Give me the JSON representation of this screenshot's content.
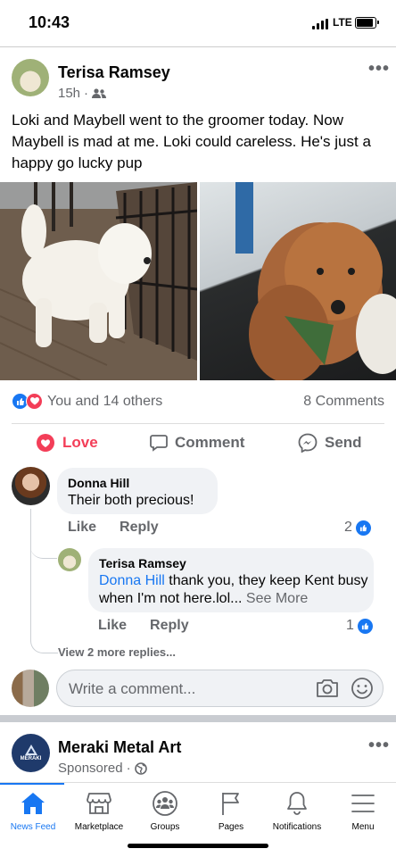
{
  "status_bar": {
    "time": "10:43",
    "network": "LTE"
  },
  "post": {
    "author": "Terisa Ramsey",
    "timestamp": "15h",
    "meta_separator": "·",
    "audience_icon": "friends-icon",
    "more_icon": "more-dots-icon",
    "text": "Loki and Maybell  went to the groomer today. Now Maybell is mad at me. Loki could careless. He's just a happy go lucky pup",
    "reactions_text": "You and 14 others",
    "comments_count": "8 Comments",
    "actions": {
      "love": "Love",
      "comment": "Comment",
      "send": "Send"
    }
  },
  "comments": [
    {
      "author": "Donna Hill",
      "text": "Their both precious!",
      "like": "Like",
      "reply": "Reply",
      "reaction_count": "2"
    }
  ],
  "reply": {
    "author": "Terisa Ramsey",
    "mention": "Donna Hill",
    "text": " thank you,  they keep Kent busy when I'm not here.lol...",
    "see_more": "See More",
    "like": "Like",
    "reply": "Reply",
    "reaction_count": "1"
  },
  "view_more_replies": "View 2 more replies...",
  "comment_input": {
    "placeholder": "Write a comment..."
  },
  "sponsored": {
    "name": "Meraki Metal Art",
    "meta": "Sponsored",
    "separator": "·",
    "logo_text": "MERAKI"
  },
  "tabs": [
    {
      "label": "News Feed",
      "icon": "home-icon",
      "active": true
    },
    {
      "label": "Marketplace",
      "icon": "store-icon"
    },
    {
      "label": "Groups",
      "icon": "groups-icon"
    },
    {
      "label": "Pages",
      "icon": "flag-icon"
    },
    {
      "label": "Notifications",
      "icon": "bell-icon"
    },
    {
      "label": "Menu",
      "icon": "hamburger-icon"
    }
  ],
  "colors": {
    "accent": "#1877f2",
    "love": "#f33e58",
    "secondary_text": "#65676b",
    "bubble": "#f0f2f5"
  }
}
